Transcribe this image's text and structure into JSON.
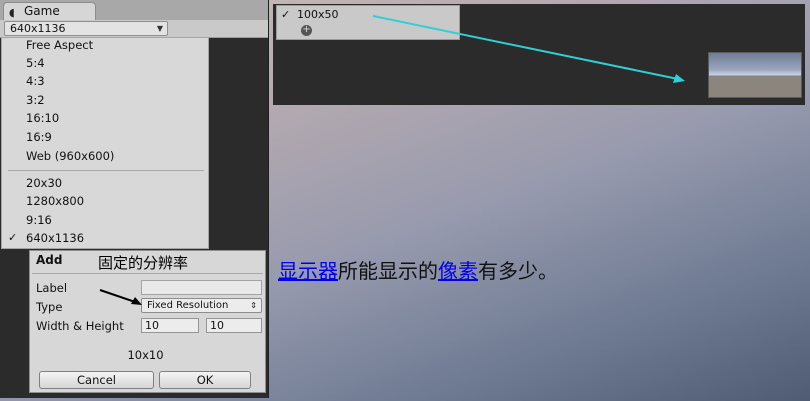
{
  "game_tab": {
    "label": "Game",
    "icon": "pacman-icon"
  },
  "aspect_dropdown": {
    "value": "640x1136"
  },
  "resolution_menu": {
    "group1": [
      {
        "label": "Free Aspect",
        "checked": false
      },
      {
        "label": "5:4",
        "checked": false
      },
      {
        "label": "4:3",
        "checked": false
      },
      {
        "label": "3:2",
        "checked": false
      },
      {
        "label": "16:10",
        "checked": false
      },
      {
        "label": "16:9",
        "checked": false
      },
      {
        "label": "Web (960x600)",
        "checked": false
      }
    ],
    "group2": [
      {
        "label": "20x30",
        "checked": false
      },
      {
        "label": "1280x800",
        "checked": false
      },
      {
        "label": "9:16",
        "checked": false
      },
      {
        "label": "640x1136",
        "checked": true
      }
    ],
    "check_glyph": "✓"
  },
  "add_dialog": {
    "title": "Add",
    "label_field": {
      "label": "Label",
      "value": ""
    },
    "type_field": {
      "label": "Type",
      "value": "Fixed Resolution"
    },
    "size_field": {
      "label": "Width & Height",
      "width": "10",
      "height": "10"
    },
    "preview": "10x10",
    "cancel": "Cancel",
    "ok": "OK"
  },
  "annotation": {
    "fixed_resolution": "固定的分辨率"
  },
  "preset": {
    "check": "✓",
    "label": "100x50",
    "add_icon": "plus-circle-icon"
  },
  "caption": {
    "link1": "显示器",
    "text1": "所能显示的",
    "link2": "像素",
    "text2": "有多少。"
  },
  "colors": {
    "arrow_cyan": "#2fd0d4",
    "panel_dark": "#2b2b2b"
  }
}
